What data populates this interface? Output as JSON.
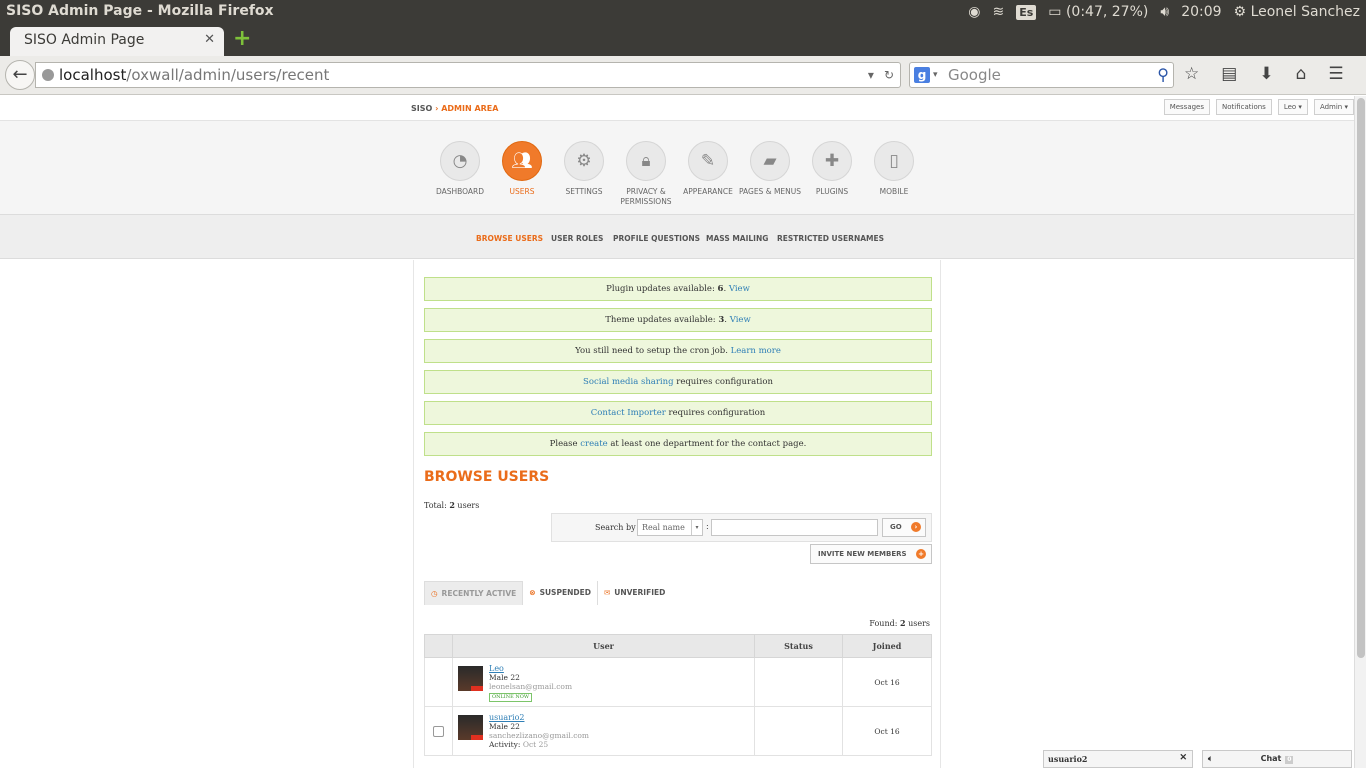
{
  "os": {
    "window_title": "SISO Admin Page - Mozilla Firefox",
    "keyboard": "Es",
    "battery": "(0:47, 27%)",
    "clock": "20:09",
    "user": "Leonel Sanchez"
  },
  "browser": {
    "tab_title": "SISO Admin Page",
    "url_host": "localhost",
    "url_path": "/oxwall/admin/users/recent",
    "search_placeholder": "Google"
  },
  "admin": {
    "breadcrumb_site": "SISO",
    "breadcrumb_area": "ADMIN AREA",
    "top_buttons": [
      "Messages",
      "Notifications",
      "Leo ▾",
      "Admin ▾"
    ],
    "nav": [
      {
        "label": "DASHBOARD"
      },
      {
        "label": "USERS"
      },
      {
        "label": "SETTINGS"
      },
      {
        "label": "PRIVACY & PERMISSIONS"
      },
      {
        "label": "APPEARANCE"
      },
      {
        "label": "PAGES & MENUS"
      },
      {
        "label": "PLUGINS"
      },
      {
        "label": "MOBILE"
      }
    ],
    "subnav": [
      "BROWSE USERS",
      "USER ROLES",
      "PROFILE QUESTIONS",
      "MASS MAILING",
      "RESTRICTED USERNAMES"
    ]
  },
  "notices": [
    {
      "pre": "Plugin updates available: ",
      "bold": "6",
      "mid": ". ",
      "link": "View",
      "post": ""
    },
    {
      "pre": "Theme updates available: ",
      "bold": "3",
      "mid": ". ",
      "link": "View",
      "post": ""
    },
    {
      "pre": "You still need to setup the cron job. ",
      "bold": "",
      "mid": "",
      "link": "Learn more",
      "post": ""
    },
    {
      "pre": "",
      "bold": "",
      "mid": "",
      "link": "Social media sharing",
      "post": " requires configuration"
    },
    {
      "pre": "",
      "bold": "",
      "mid": "",
      "link": "Contact Importer",
      "post": " requires configuration"
    },
    {
      "pre": "Please ",
      "bold": "",
      "mid": "",
      "link": "create",
      "post": " at least one department for the contact page."
    }
  ],
  "browse": {
    "title": "BROWSE USERS",
    "total_pre": "Total: ",
    "total_num": "2",
    "total_post": " users",
    "search_label": "Search by",
    "search_select": "Real name",
    "go_label": "GO",
    "invite_label": "INVITE NEW MEMBERS",
    "tabs": [
      "RECENTLY ACTIVE",
      "SUSPENDED",
      "UNVERIFIED"
    ],
    "found_pre": "Found: ",
    "found_num": "2",
    "found_post": " users",
    "columns": [
      "User",
      "Status",
      "Joined"
    ],
    "users": [
      {
        "name": "Leo",
        "info": "Male 22",
        "email": "leonelsan@gmail.com",
        "badge": "ONLINE NOW",
        "activity_label": "",
        "activity": "",
        "joined": "Oct 16",
        "checkbox": false
      },
      {
        "name": "usuario2",
        "info": "Male 22",
        "email": "sanchezlizano@gmail.com",
        "badge": "",
        "activity_label": "Activity: ",
        "activity": "Oct 25",
        "joined": "Oct 16",
        "checkbox": true
      }
    ]
  },
  "chat": {
    "window_user": "usuario2",
    "label": "Chat",
    "count": "0"
  }
}
